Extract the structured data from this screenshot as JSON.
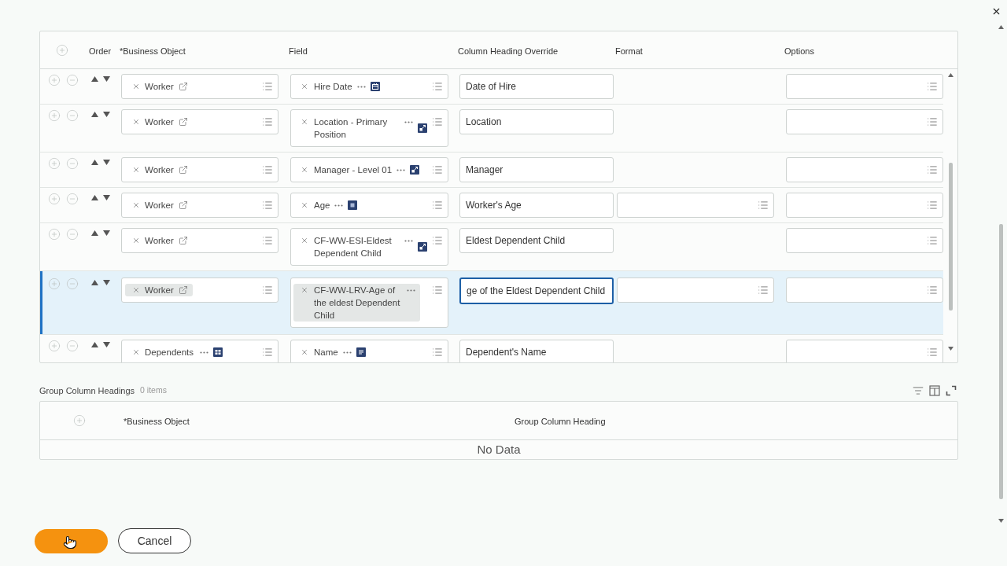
{
  "columns_table": {
    "headers": [
      "Order",
      "*Business Object",
      "Field",
      "Column Heading Override",
      "Format",
      "Options"
    ],
    "rows": [
      {
        "selected": false,
        "business_object": {
          "text": "Worker",
          "kind": "link"
        },
        "field": {
          "text": "Hire Date",
          "kind": "date"
        },
        "heading": "Date of Hire",
        "format_field": false
      },
      {
        "selected": false,
        "business_object": {
          "text": "Worker",
          "kind": "link"
        },
        "field": {
          "text": "Location - Primary Position",
          "kind": "instance"
        },
        "heading": "Location",
        "format_field": false
      },
      {
        "selected": false,
        "business_object": {
          "text": "Worker",
          "kind": "link"
        },
        "field": {
          "text": "Manager - Level 01",
          "kind": "instance"
        },
        "heading": "Manager",
        "format_field": false
      },
      {
        "selected": false,
        "business_object": {
          "text": "Worker",
          "kind": "link"
        },
        "field": {
          "text": "Age",
          "kind": "number"
        },
        "heading": "Worker's Age",
        "format_field": true
      },
      {
        "selected": false,
        "business_object": {
          "text": "Worker",
          "kind": "link"
        },
        "field": {
          "text": "CF-WW-ESI-Eldest Dependent Child",
          "kind": "instance"
        },
        "heading": "Eldest Dependent Child",
        "format_field": false
      },
      {
        "selected": true,
        "business_object": {
          "text": "Worker",
          "kind": "link"
        },
        "field": {
          "text": "CF-WW-LRV-Age of the eldest Dependent Child"
        },
        "heading": "ge of the Eldest Dependent Child",
        "format_field": true
      },
      {
        "selected": false,
        "business_object": {
          "text": "Dependents",
          "kind": "multi"
        },
        "field": {
          "text": "Name",
          "kind": "text"
        },
        "heading": "Dependent's Name",
        "format_field": false
      }
    ]
  },
  "group_column_headings": {
    "title": "Group Column Headings",
    "count": "0 items",
    "headers": [
      "*Business Object",
      "Group Column Heading"
    ],
    "empty_message": "No Data"
  },
  "buttons": [
    {
      "kind": "primary"
    },
    {
      "kind": "secondary",
      "label": "Cancel"
    }
  ]
}
